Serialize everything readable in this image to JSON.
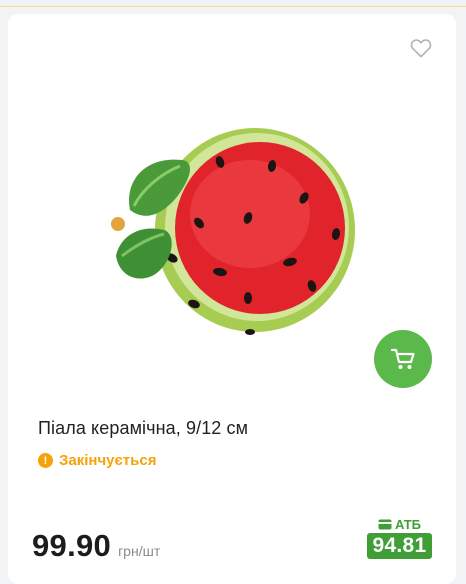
{
  "product": {
    "title": "Піала керамічна, 9/12 см",
    "status_text": "Закінчується",
    "image_alt": "watermelon ceramic bowl"
  },
  "price": {
    "value": "99.90",
    "unit": "грн/шт"
  },
  "loyalty": {
    "label": "АТБ",
    "price": "94.81"
  },
  "icons": {
    "favorite": "heart-outline-icon",
    "cart": "cart-icon",
    "status": "exclamation-circle-icon",
    "card": "credit-card-icon"
  },
  "colors": {
    "accent_green": "#5bb84a",
    "loyalty_green": "#3f9e36",
    "status_orange": "#f5a30a"
  }
}
